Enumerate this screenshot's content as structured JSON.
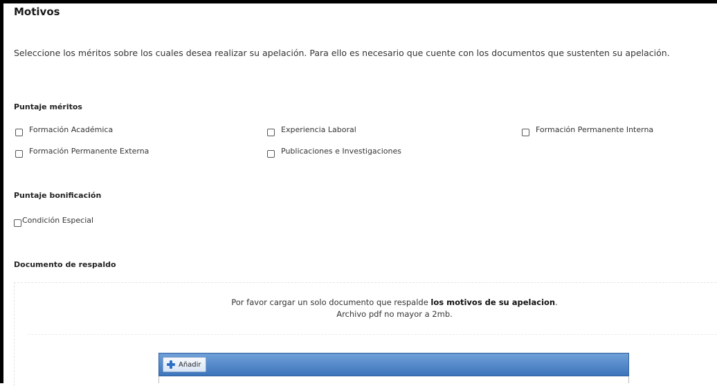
{
  "motivos": {
    "title": "Motivos",
    "description": "Seleccione los méritos sobre los cuales desea realizar su apelación. Para ello es necesario que cuente con los documentos que sustenten su apelación."
  },
  "puntaje_meritos": {
    "heading": "Puntaje méritos",
    "options": [
      {
        "label": "Formación Académica",
        "checked": false
      },
      {
        "label": "Experiencia Laboral",
        "checked": false
      },
      {
        "label": "Formación Permanente Interna",
        "checked": false
      },
      {
        "label": "Formación Permanente Externa",
        "checked": false
      },
      {
        "label": "Publicaciones e Investigaciones",
        "checked": false
      }
    ]
  },
  "puntaje_bonificacion": {
    "heading": "Puntaje bonificación",
    "options": [
      {
        "label": "Condición Especial",
        "checked": false
      }
    ]
  },
  "documento": {
    "heading": "Documento de respaldo",
    "instruction_prefix": "Por favor cargar un solo documento que respalde ",
    "instruction_bold": "los motivos de su apelacion",
    "instruction_suffix": ".",
    "file_note": "Archivo pdf no mayor a 2mb.",
    "add_button_label": "Añadir",
    "add_icon": "plus-icon",
    "toolbar_color": "#4a80c4"
  }
}
